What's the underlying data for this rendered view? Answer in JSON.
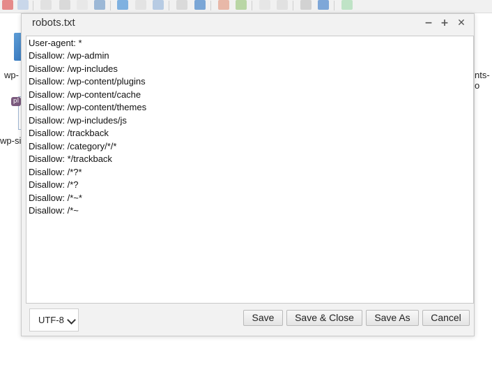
{
  "background": {
    "labels": [
      "wp-",
      "wp-si",
      "nts-",
      "o"
    ],
    "badge": "pl"
  },
  "dialog": {
    "title": "robots.txt",
    "controls": {
      "minimize": "−",
      "maximize": "+",
      "close": "✕"
    },
    "lines": [
      "User-agent: *",
      "Disallow: /wp-admin",
      "Disallow: /wp-includes",
      "Disallow: /wp-content/plugins",
      "Disallow: /wp-content/cache",
      "Disallow: /wp-content/themes",
      "Disallow: /wp-includes/js",
      "Disallow: /trackback",
      "Disallow: /category/*/*",
      "Disallow: */trackback",
      "Disallow: /*?*",
      "Disallow: /*?",
      "Disallow: /*~*",
      "Disallow: /*~"
    ],
    "encoding": "UTF-8",
    "buttons": {
      "save": "Save",
      "save_close": "Save & Close",
      "save_as": "Save As",
      "cancel": "Cancel"
    }
  }
}
